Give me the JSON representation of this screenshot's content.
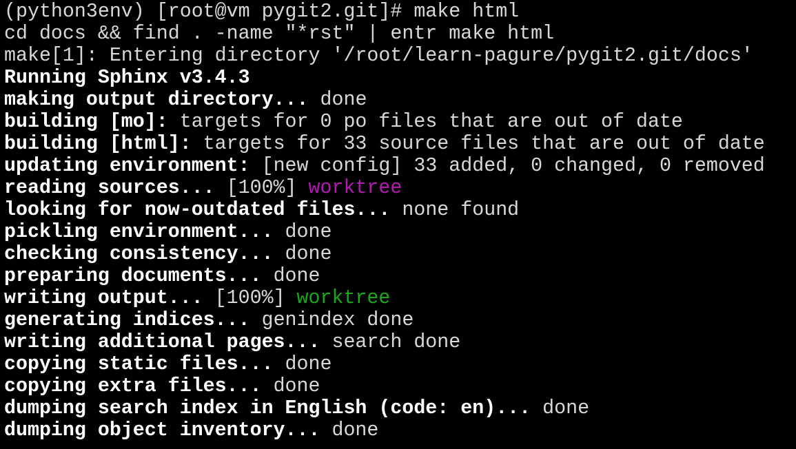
{
  "terminal": {
    "colors": {
      "background": "#000000",
      "text": "#d8d8d8",
      "bold_text": "#ffffff",
      "magenta": "#b21ab2",
      "green": "#1aa81a"
    },
    "lines": [
      {
        "segments": [
          {
            "text": "(python3env) [root@vm pygit2.git]# make html"
          }
        ]
      },
      {
        "segments": [
          {
            "text": "cd docs && find . -name \"*rst\" | entr make html"
          }
        ]
      },
      {
        "segments": [
          {
            "text": "make[1]: Entering directory '/root/learn-pagure/pygit2.git/docs'"
          }
        ]
      },
      {
        "segments": [
          {
            "text": "Running Sphinx v3.4.3"
          }
        ]
      },
      {
        "segments": [
          {
            "text": "making output directory..."
          },
          {
            "text": " done"
          }
        ]
      },
      {
        "segments": [
          {
            "text": "building [mo]:"
          },
          {
            "text": " targets for 0 po files that are out of date"
          }
        ]
      },
      {
        "segments": [
          {
            "text": "building [html]:"
          },
          {
            "text": " targets for 33 source files that are out of date"
          }
        ]
      },
      {
        "segments": [
          {
            "text": "updating environment:"
          },
          {
            "text": " [new config] 33 added, 0 changed, 0 removed"
          }
        ]
      },
      {
        "segments": [
          {
            "text": "reading sources..."
          },
          {
            "text": " [100%] "
          },
          {
            "text": "worktree"
          }
        ]
      },
      {
        "segments": [
          {
            "text": "looking for now-outdated files..."
          },
          {
            "text": " none found"
          }
        ]
      },
      {
        "segments": [
          {
            "text": "pickling environment..."
          },
          {
            "text": " done"
          }
        ]
      },
      {
        "segments": [
          {
            "text": "checking consistency..."
          },
          {
            "text": " done"
          }
        ]
      },
      {
        "segments": [
          {
            "text": "preparing documents..."
          },
          {
            "text": " done"
          }
        ]
      },
      {
        "segments": [
          {
            "text": "writing output..."
          },
          {
            "text": " [100%] "
          },
          {
            "text": "worktree"
          }
        ]
      },
      {
        "segments": [
          {
            "text": "generating indices..."
          },
          {
            "text": " genindex done"
          }
        ]
      },
      {
        "segments": [
          {
            "text": "writing additional pages..."
          },
          {
            "text": " search done"
          }
        ]
      },
      {
        "segments": [
          {
            "text": "copying static files..."
          },
          {
            "text": " done"
          }
        ]
      },
      {
        "segments": [
          {
            "text": "copying extra files..."
          },
          {
            "text": " done"
          }
        ]
      },
      {
        "segments": [
          {
            "text": "dumping search index in English (code: en)..."
          },
          {
            "text": " done"
          }
        ]
      },
      {
        "segments": [
          {
            "text": "dumping object inventory..."
          },
          {
            "text": " done"
          }
        ]
      }
    ]
  }
}
